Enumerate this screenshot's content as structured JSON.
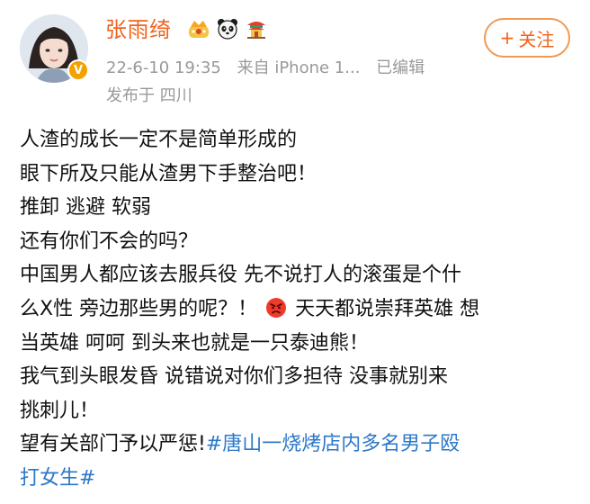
{
  "user": {
    "name": "张雨绮",
    "verified_badge": "V",
    "follow_button": {
      "plus": "+",
      "label": "关注"
    },
    "badges": [
      "crown-icon",
      "panda-icon",
      "pagoda-icon"
    ]
  },
  "meta": {
    "date": "22-6-10 19:35",
    "source": "来自 iPhone 1...",
    "edited": "已编辑",
    "location": "发布于 四川"
  },
  "post": {
    "line1": "人渣的成长一定不是简单形成的",
    "line2": "眼下所及只能从渣男下手整治吧！",
    "line3": "推卸 逃避 软弱",
    "line4": "还有你们不会的吗？",
    "line5": "中国男人都应该去服兵役 先不说打人的滚蛋是个什",
    "line6a": "么X性 旁边那些男的呢？！",
    "line6b": "天天都说崇拜英雄 想",
    "line7": "当英雄 呵呵 到头来也就是一只泰迪熊！",
    "line8": "我气到头眼发昏 说错说对你们多担待 没事就别来",
    "line9": "挑刺儿！",
    "line10_text": "望有关部门予以严惩!",
    "hashtag_part1": "#唐山一烧烤店内多名男子殴",
    "hashtag_part2": "打女生#"
  },
  "colors": {
    "username": "#f0631d",
    "meta": "#999999",
    "hashtag": "#2c78c8",
    "follow_border": "#f09a54",
    "verified": "#f2a200"
  }
}
